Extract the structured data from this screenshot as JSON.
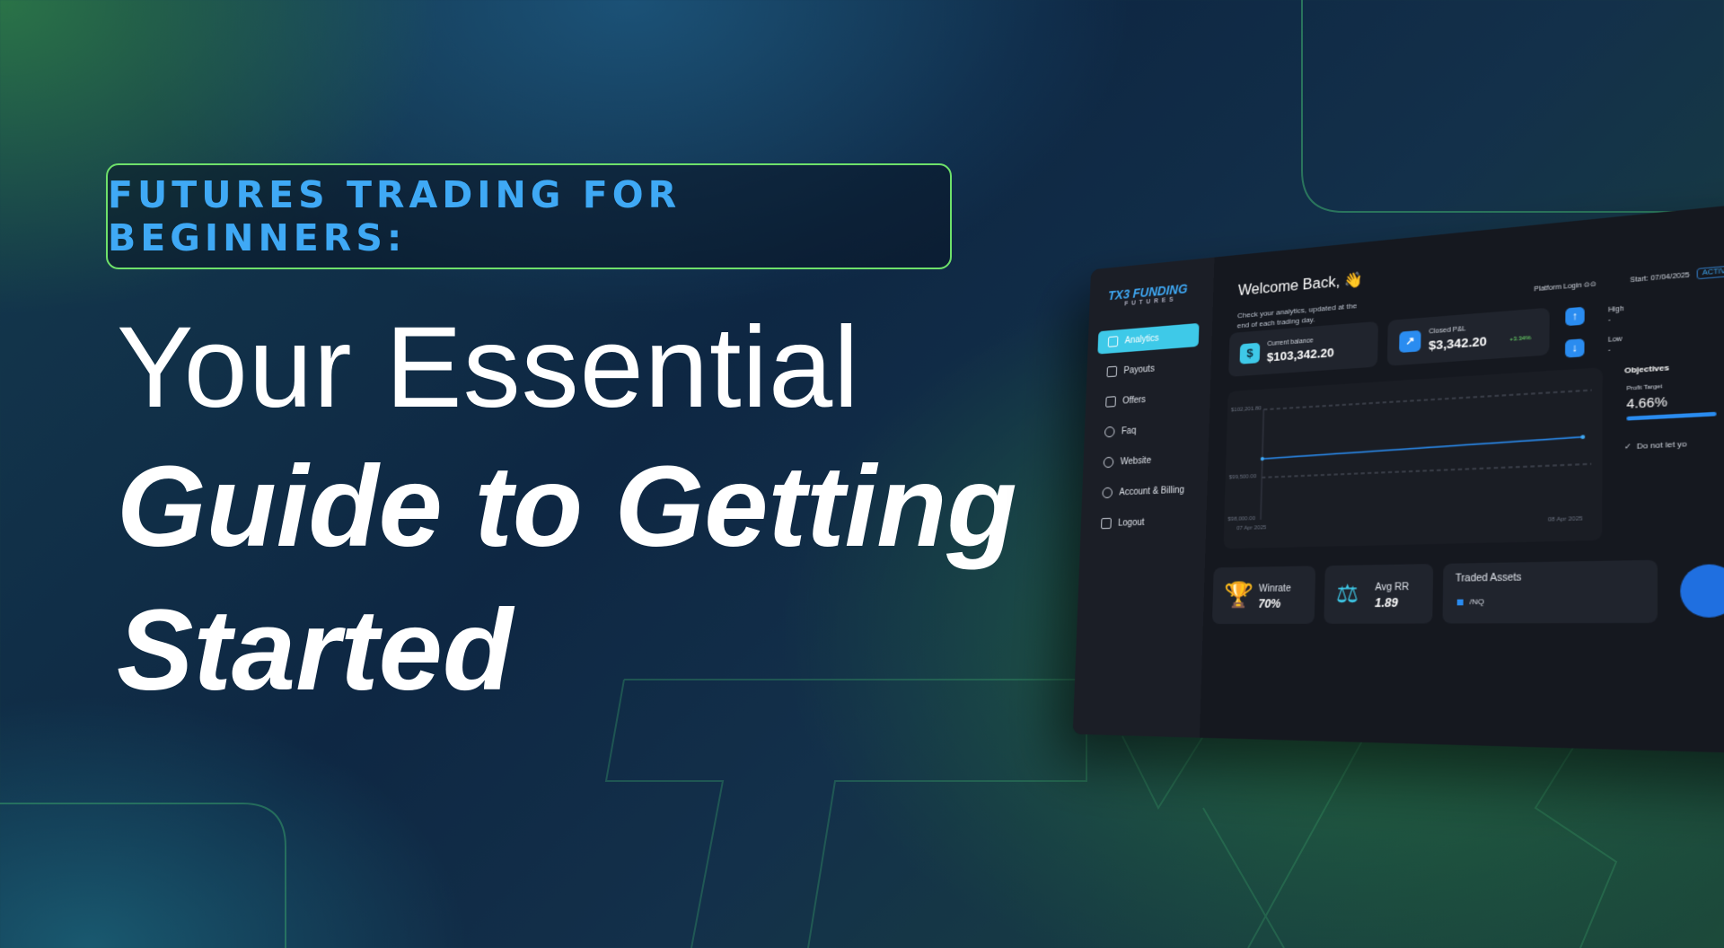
{
  "eyebrow": "FUTURES TRADING FOR BEGINNERS:",
  "headline": {
    "line1": "Your Essential",
    "line2": "Guide to Getting",
    "line3": "Started"
  },
  "colors": {
    "accent_green": "#6ee06a",
    "accent_blue": "#3fa9f5",
    "accent_cyan": "#3ec9e8"
  },
  "dashboard": {
    "logo": "TX3 FUNDING",
    "logo_sub": "FUTURES",
    "nav": [
      {
        "label": "Analytics",
        "icon": "chart-icon",
        "active": true
      },
      {
        "label": "Payouts",
        "icon": "wallet-icon",
        "active": false
      },
      {
        "label": "Offers",
        "icon": "ticket-icon",
        "active": false
      },
      {
        "label": "Faq",
        "icon": "question-icon",
        "active": false
      },
      {
        "label": "Website",
        "icon": "globe-icon",
        "active": false
      },
      {
        "label": "Account & Billing",
        "icon": "user-icon",
        "active": false
      },
      {
        "label": "Logout",
        "icon": "logout-icon",
        "active": false
      }
    ],
    "welcome": "Welcome Back, 👋",
    "subtitle": "Check your analytics, updated at the end of each trading day.",
    "platform_login": "Platform Login ⊙⊙",
    "start": "Start: 07/04/2025",
    "status": "ACTIVE",
    "current_balance_label": "Current balance",
    "current_balance": "$103,342.20",
    "closed_pnl_label": "Closed P&L",
    "closed_pnl": "$3,342.20",
    "closed_pnl_pct": "+3.34%",
    "high_label": "High",
    "high_value": "-",
    "low_label": "Low",
    "low_value": "-",
    "chart_y_top": "$102,201.80",
    "chart_y_mid": "$99,500.00",
    "chart_y_bottom": "$98,000.00",
    "chart_x_start": "07 Apr 2025",
    "chart_x_end": "08 Apr 2025",
    "objectives_title": "Objectives",
    "profit_target_label": "Profit Target",
    "profit_target_value": "4.66%",
    "rule_text": "Do not let yo",
    "winrate_label": "Winrate",
    "winrate_value": "70%",
    "avg_rr_label": "Avg RR",
    "avg_rr_value": "1.89",
    "traded_assets_label": "Traded Assets",
    "traded_asset": "/NQ"
  }
}
